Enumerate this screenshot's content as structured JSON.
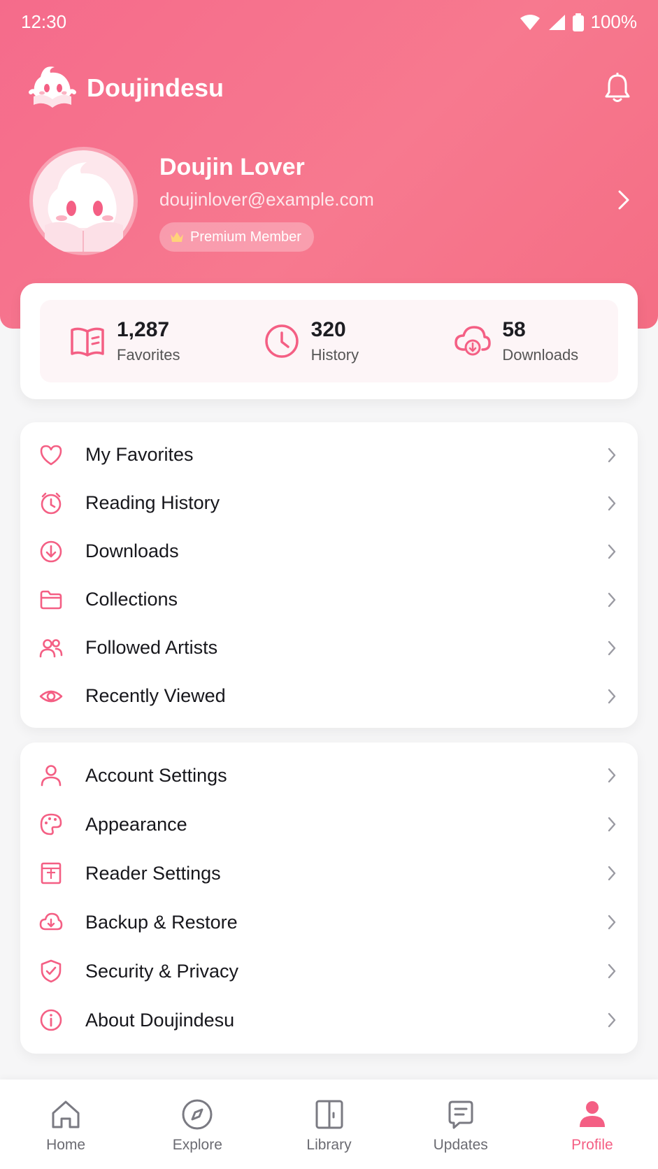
{
  "status_bar": {
    "time": "12:30",
    "battery": "100%"
  },
  "app": {
    "title": "Doujindesu"
  },
  "profile": {
    "name": "Doujin Lover",
    "email": "doujinlover@example.com",
    "badge": "Premium Member"
  },
  "stats": [
    {
      "value": "1,287",
      "label": "Favorites"
    },
    {
      "value": "320",
      "label": "History"
    },
    {
      "value": "58",
      "label": "Downloads"
    }
  ],
  "menu_library": [
    {
      "label": "My Favorites",
      "icon": "heart-icon"
    },
    {
      "label": "Reading History",
      "icon": "history-icon"
    },
    {
      "label": "Downloads",
      "icon": "download-icon"
    },
    {
      "label": "Collections",
      "icon": "folder-icon"
    },
    {
      "label": "Followed Artists",
      "icon": "users-icon"
    },
    {
      "label": "Recently Viewed",
      "icon": "eye-icon"
    }
  ],
  "menu_settings": [
    {
      "label": "Account Settings",
      "icon": "user-icon"
    },
    {
      "label": "Appearance",
      "icon": "palette-icon"
    },
    {
      "label": "Reader Settings",
      "icon": "reader-icon"
    },
    {
      "label": "Backup & Restore",
      "icon": "cloud-icon"
    },
    {
      "label": "Security & Privacy",
      "icon": "shield-icon"
    },
    {
      "label": "About Doujindesu",
      "icon": "info-icon"
    }
  ],
  "bottom_nav": [
    {
      "label": "Home",
      "icon": "home-icon"
    },
    {
      "label": "Explore",
      "icon": "compass-icon"
    },
    {
      "label": "Library",
      "icon": "library-icon"
    },
    {
      "label": "Updates",
      "icon": "updates-icon"
    },
    {
      "label": "Profile",
      "icon": "profile-icon",
      "active": true
    }
  ],
  "colors": {
    "accent": "#f45f84",
    "header": "#f56b8b"
  }
}
